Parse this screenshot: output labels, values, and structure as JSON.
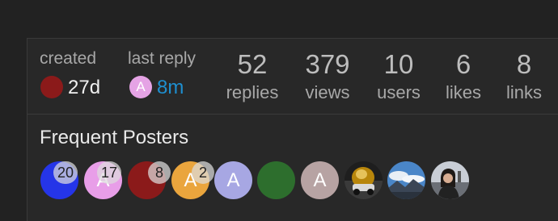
{
  "meta": {
    "created": {
      "label": "created",
      "value": "27d",
      "avatar_color": "#8b1a1a"
    },
    "last_reply": {
      "label": "last reply",
      "value": "8m",
      "avatar_letter": "A",
      "avatar_color": "#e5a3e5",
      "value_color": "#1e8fd0"
    }
  },
  "stats": [
    {
      "number": "52",
      "label": "replies"
    },
    {
      "number": "379",
      "label": "views"
    },
    {
      "number": "10",
      "label": "users"
    },
    {
      "number": "6",
      "label": "likes"
    },
    {
      "number": "8",
      "label": "links"
    }
  ],
  "frequent_posters": {
    "title": "Frequent Posters",
    "posters": [
      {
        "letter": "",
        "color": "#2535e8",
        "count": "20"
      },
      {
        "letter": "A",
        "color": "#e89ee8",
        "count": "17"
      },
      {
        "letter": "",
        "color": "#8b1a1a",
        "count": "8"
      },
      {
        "letter": "A",
        "color": "#eaa53d",
        "count": "2"
      },
      {
        "letter": "A",
        "color": "#a7a7e3",
        "count": ""
      },
      {
        "letter": "",
        "color": "#2d6e2d",
        "count": ""
      },
      {
        "letter": "A",
        "color": "#b7a3a3",
        "count": ""
      },
      {
        "letter": "",
        "color": "photo-golden-car",
        "count": ""
      },
      {
        "letter": "",
        "color": "photo-sky-mountains",
        "count": ""
      },
      {
        "letter": "",
        "color": "photo-person-portrait",
        "count": ""
      }
    ]
  }
}
